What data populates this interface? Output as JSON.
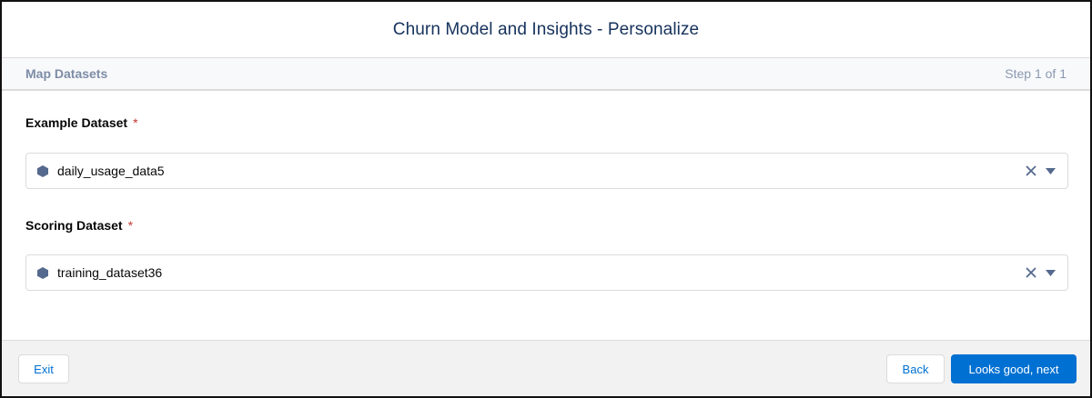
{
  "modal": {
    "title": "Churn Model and Insights - Personalize"
  },
  "subheader": {
    "section": "Map Datasets",
    "step": "Step 1 of 1"
  },
  "fields": [
    {
      "label": "Example Dataset",
      "required_marker": "*",
      "value": "daily_usage_data5",
      "icon": "dataset-hexagon-icon"
    },
    {
      "label": "Scoring Dataset",
      "required_marker": "*",
      "value": "training_dataset36",
      "icon": "dataset-hexagon-icon"
    }
  ],
  "footer": {
    "exit_label": "Exit",
    "back_label": "Back",
    "next_label": "Looks good, next"
  },
  "colors": {
    "brand": "#0070d2",
    "required": "#c23934",
    "icon": "#54698d"
  }
}
